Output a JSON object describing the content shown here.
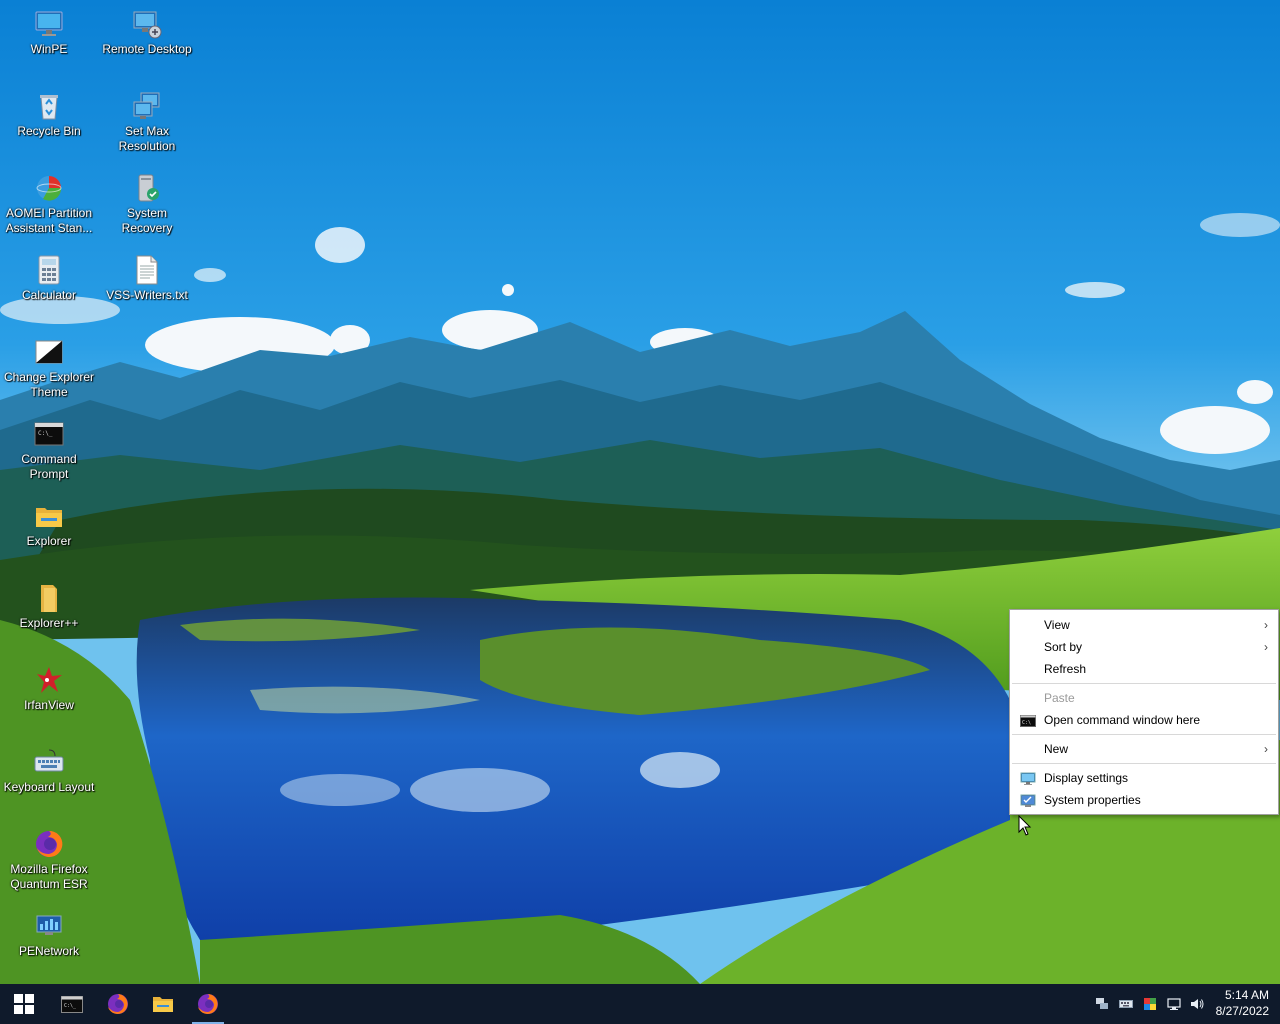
{
  "desktop": {
    "icons": [
      {
        "label": "WinPE",
        "icon": "monitor-icon"
      },
      {
        "label": "Remote Desktop",
        "icon": "remote-desktop-icon"
      },
      {
        "label": "Recycle Bin",
        "icon": "recycle-bin-icon"
      },
      {
        "label": "Set Max Resolution",
        "icon": "set-resolution-icon"
      },
      {
        "label": "AOMEI Partition Assistant Stan...",
        "icon": "aomei-partition-icon"
      },
      {
        "label": "System Recovery",
        "icon": "system-recovery-icon"
      },
      {
        "label": "Calculator",
        "icon": "calculator-icon"
      },
      {
        "label": "VSS-Writers.txt",
        "icon": "text-file-icon"
      },
      {
        "label": "Change Explorer Theme",
        "icon": "explorer-theme-icon"
      },
      {
        "label": "Command Prompt",
        "icon": "command-prompt-icon"
      },
      {
        "label": "Explorer",
        "icon": "folder-icon"
      },
      {
        "label": "Explorer++",
        "icon": "explorer-plus-plus-icon"
      },
      {
        "label": "IrfanView",
        "icon": "irfanview-icon"
      },
      {
        "label": "Keyboard Layout",
        "icon": "keyboard-icon"
      },
      {
        "label": "Mozilla Firefox Quantum ESR",
        "icon": "firefox-icon"
      },
      {
        "label": "PENetwork",
        "icon": "network-icon"
      }
    ]
  },
  "context_menu": {
    "items": [
      {
        "label": "View",
        "submenu": true,
        "enabled": true
      },
      {
        "label": "Sort by",
        "submenu": true,
        "enabled": true
      },
      {
        "label": "Refresh",
        "submenu": false,
        "enabled": true
      },
      {
        "label": "Paste",
        "submenu": false,
        "enabled": false
      },
      {
        "label": "Open command window here",
        "submenu": false,
        "enabled": true,
        "icon": "cmd-icon"
      },
      {
        "label": "New",
        "submenu": true,
        "enabled": true
      },
      {
        "label": "Display settings",
        "submenu": false,
        "enabled": true,
        "icon": "display-icon"
      },
      {
        "label": "System properties",
        "submenu": false,
        "enabled": true,
        "icon": "system-properties-icon"
      }
    ],
    "arrow": "›"
  },
  "taskbar": {
    "buttons": [
      "start-icon",
      "command-prompt-icon",
      "firefox-icon",
      "file-explorer-icon",
      "firefox-icon"
    ],
    "tray": [
      "network-monitor-icon",
      "keyboard-icon",
      "color-icon",
      "network-icon",
      "volume-icon"
    ],
    "time": "5:14 AM",
    "date": "8/27/2022"
  },
  "colors": {
    "taskbar": "#0f1a2b",
    "menu_bg": "#ffffff",
    "active_indicator": "#7fb2e8"
  }
}
